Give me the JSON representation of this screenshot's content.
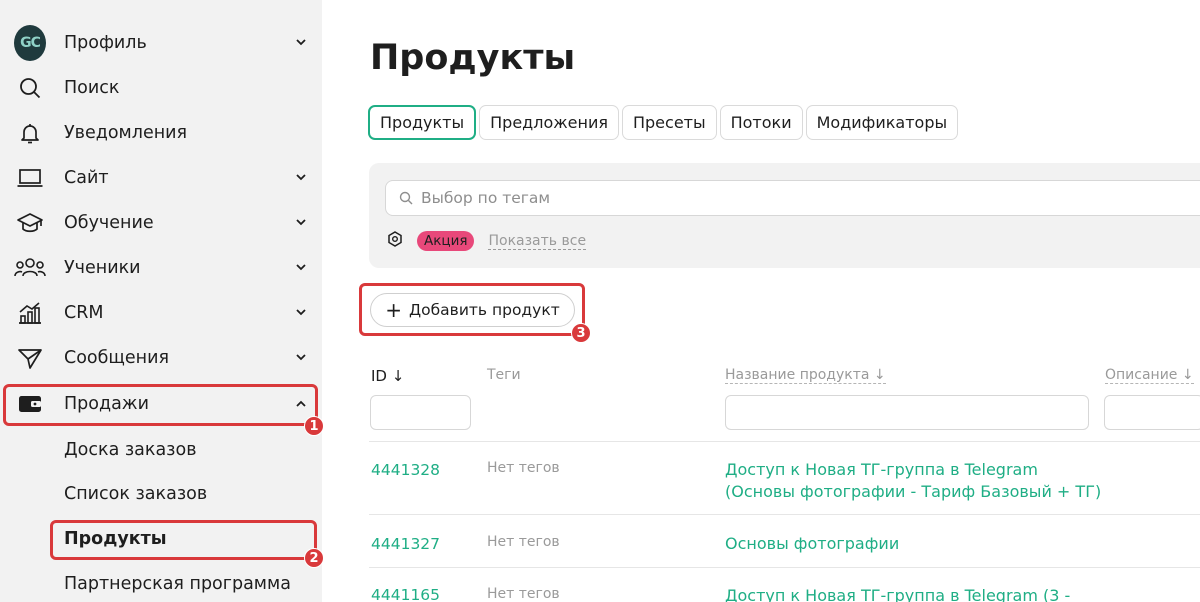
{
  "sidebar": {
    "profile": {
      "logo_text_a": "G",
      "logo_text_b": "C",
      "label": "Профиль"
    },
    "items": [
      {
        "label": "Поиск"
      },
      {
        "label": "Уведомления"
      },
      {
        "label": "Сайт"
      },
      {
        "label": "Обучение"
      },
      {
        "label": "Ученики"
      },
      {
        "label": "CRM"
      },
      {
        "label": "Сообщения"
      },
      {
        "label": "Продажи"
      }
    ],
    "sub_items": [
      {
        "label": "Доска заказов"
      },
      {
        "label": "Список заказов"
      },
      {
        "label": "Продукты"
      },
      {
        "label": "Партнерская программа"
      }
    ]
  },
  "annotations": {
    "step1": "1",
    "step2": "2",
    "step3": "3"
  },
  "colors": {
    "accent": "#1fae85",
    "highlight": "#d9393b",
    "tag": "#e8487a",
    "sidebar_bg": "#f2f2f2"
  },
  "main": {
    "title": "Продукты",
    "tabs": [
      {
        "label": "Продукты",
        "active": true
      },
      {
        "label": "Предложения"
      },
      {
        "label": "Пресеты"
      },
      {
        "label": "Потоки"
      },
      {
        "label": "Модификаторы"
      }
    ],
    "filter": {
      "placeholder": "Выбор по тегам",
      "tag": "Акция",
      "show_all": "Показать все"
    },
    "add_button": "Добавить продукт",
    "table": {
      "columns": {
        "id": "ID ↓",
        "tags": "Теги",
        "name": "Название продукта ↓",
        "description": "Описание ↓"
      },
      "rows": [
        {
          "id": "4441328",
          "tags": "Нет тегов",
          "name_line1": "Доступ к Новая ТГ-группа в Telegram",
          "name_line2": "(Основы фотографии - Тариф Базовый + ТГ)"
        },
        {
          "id": "4441327",
          "tags": "Нет тегов",
          "name_line1": "Основы фотографии",
          "name_line2": ""
        },
        {
          "id": "4441165",
          "tags": "Нет тегов",
          "name_line1": "Доступ к Новая ТГ-группа в Telegram (3 -",
          "name_line2": ""
        }
      ]
    }
  }
}
